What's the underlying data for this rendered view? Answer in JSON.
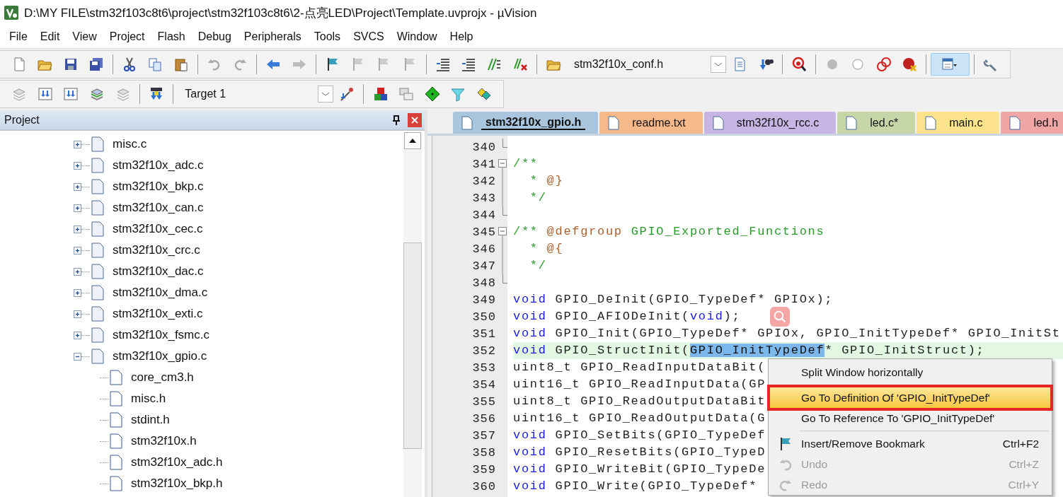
{
  "window": {
    "title": "D:\\MY FILE\\stm32f103c8t6\\project\\stm32f103c8t6\\2-点亮LED\\Project\\Template.uvprojx - µVision"
  },
  "menu_bar": [
    "File",
    "Edit",
    "View",
    "Project",
    "Flash",
    "Debug",
    "Peripherals",
    "Tools",
    "SVCS",
    "Window",
    "Help"
  ],
  "toolbar": {
    "file_combo": "stm32f10x_conf.h",
    "target_combo": "Target 1"
  },
  "project_panel": {
    "title": "Project",
    "tree": [
      {
        "label": "misc.c",
        "expanded": false
      },
      {
        "label": "stm32f10x_adc.c",
        "expanded": false
      },
      {
        "label": "stm32f10x_bkp.c",
        "expanded": false
      },
      {
        "label": "stm32f10x_can.c",
        "expanded": false
      },
      {
        "label": "stm32f10x_cec.c",
        "expanded": false
      },
      {
        "label": "stm32f10x_crc.c",
        "expanded": false
      },
      {
        "label": "stm32f10x_dac.c",
        "expanded": false
      },
      {
        "label": "stm32f10x_dma.c",
        "expanded": false
      },
      {
        "label": "stm32f10x_exti.c",
        "expanded": false
      },
      {
        "label": "stm32f10x_fsmc.c",
        "expanded": false
      },
      {
        "label": "stm32f10x_gpio.c",
        "expanded": true,
        "children": [
          {
            "label": "core_cm3.h"
          },
          {
            "label": "misc.h"
          },
          {
            "label": "stdint.h"
          },
          {
            "label": "stm32f10x.h"
          },
          {
            "label": "stm32f10x_adc.h"
          },
          {
            "label": "stm32f10x_bkp.h"
          }
        ]
      }
    ]
  },
  "editor": {
    "tabs": [
      {
        "label": "stm32f10x_gpio.h",
        "selected": true,
        "color": "#a9c6de"
      },
      {
        "label": "readme.txt",
        "selected": false,
        "color": "#f7b98a"
      },
      {
        "label": "stm32f10x_rcc.c",
        "selected": false,
        "color": "#c7b5e3"
      },
      {
        "label": "led.c*",
        "selected": false,
        "color": "#c6d6a9"
      },
      {
        "label": "main.c",
        "selected": false,
        "color": "#fde48c"
      },
      {
        "label": "led.h",
        "selected": false,
        "color": "#f1a6a6"
      }
    ],
    "lines": [
      {
        "number": "340",
        "kind": "fold-end",
        "current": false
      },
      {
        "number": "341",
        "kind": "fold-start",
        "current": false,
        "segments": [
          {
            "kind": "comment",
            "text": "/**"
          }
        ]
      },
      {
        "number": "342",
        "kind": "fold-body",
        "current": false,
        "segments": [
          {
            "kind": "comment",
            "text": "  * "
          },
          {
            "kind": "tag",
            "text": "@}"
          }
        ]
      },
      {
        "number": "343",
        "kind": "fold-body",
        "current": false,
        "segments": [
          {
            "kind": "comment",
            "text": "  */"
          }
        ]
      },
      {
        "number": "344",
        "kind": "fold-end",
        "current": false
      },
      {
        "number": "345",
        "kind": "fold-start",
        "current": false,
        "segments": [
          {
            "kind": "comment",
            "text": "/** "
          },
          {
            "kind": "tag",
            "text": "@defgroup"
          },
          {
            "kind": "comment",
            "text": " GPIO_Exported_Functions"
          }
        ]
      },
      {
        "number": "346",
        "kind": "fold-body",
        "current": false,
        "segments": [
          {
            "kind": "comment",
            "text": "  * "
          },
          {
            "kind": "tag",
            "text": "@{"
          }
        ]
      },
      {
        "number": "347",
        "kind": "fold-body",
        "current": false,
        "segments": [
          {
            "kind": "comment",
            "text": "  */"
          }
        ]
      },
      {
        "number": "348",
        "kind": "fold-end",
        "current": false
      },
      {
        "number": "349",
        "current": false,
        "segments": [
          {
            "kind": "keyword",
            "text": "void"
          },
          {
            "kind": "plain",
            "text": " GPIO_DeInit(GPIO_TypeDef* GPIOx);"
          }
        ]
      },
      {
        "number": "350",
        "current": false,
        "segments": [
          {
            "kind": "keyword",
            "text": "void"
          },
          {
            "kind": "plain",
            "text": " GPIO_AFIODeInit("
          },
          {
            "kind": "keyword",
            "text": "void"
          },
          {
            "kind": "plain",
            "text": ");"
          }
        ]
      },
      {
        "number": "351",
        "current": false,
        "segments": [
          {
            "kind": "keyword",
            "text": "void"
          },
          {
            "kind": "plain",
            "text": " GPIO_Init(GPIO_TypeDef* GPIOx, GPIO_InitTypeDef* GPIO_InitSt"
          }
        ]
      },
      {
        "number": "352",
        "current": true,
        "segments": [
          {
            "kind": "keyword",
            "text": "void"
          },
          {
            "kind": "plain",
            "text": " GPIO_StructInit("
          },
          {
            "kind": "selection",
            "text": "GPIO_InitTypeDef"
          },
          {
            "kind": "plain",
            "text": "* GPIO_InitStruct);"
          }
        ]
      },
      {
        "number": "353",
        "current": false,
        "segments": [
          {
            "kind": "plain",
            "text": "uint8_t GPIO_ReadInputDataBit("
          }
        ]
      },
      {
        "number": "354",
        "current": false,
        "segments": [
          {
            "kind": "plain",
            "text": "uint16_t GPIO_ReadInputData(GP"
          }
        ]
      },
      {
        "number": "355",
        "current": false,
        "segments": [
          {
            "kind": "plain",
            "text": "uint8_t GPIO_ReadOutputDataBit"
          }
        ]
      },
      {
        "number": "356",
        "current": false,
        "segments": [
          {
            "kind": "plain",
            "text": "uint16_t GPIO_ReadOutputData(G"
          }
        ]
      },
      {
        "number": "357",
        "current": false,
        "segments": [
          {
            "kind": "keyword",
            "text": "void"
          },
          {
            "kind": "plain",
            "text": " GPIO_SetBits(GPIO_TypeDef"
          }
        ]
      },
      {
        "number": "358",
        "current": false,
        "segments": [
          {
            "kind": "keyword",
            "text": "void"
          },
          {
            "kind": "plain",
            "text": " GPIO_ResetBits(GPIO_TypeD"
          }
        ]
      },
      {
        "number": "359",
        "current": false,
        "segments": [
          {
            "kind": "keyword",
            "text": "void"
          },
          {
            "kind": "plain",
            "text": " GPIO_WriteBit(GPIO_TypeDe"
          }
        ]
      },
      {
        "number": "360",
        "current": false,
        "segments": [
          {
            "kind": "keyword",
            "text": "void"
          },
          {
            "kind": "plain",
            "text": " GPIO_Write(GPIO_TypeDef*"
          }
        ]
      }
    ]
  },
  "context_menu": [
    {
      "kind": "item",
      "label": "Split Window horizontally",
      "selected": false,
      "disabled": false
    },
    {
      "kind": "separator"
    },
    {
      "kind": "item",
      "label": "Go To Definition Of 'GPIO_InitTypeDef'",
      "selected": true,
      "disabled": false
    },
    {
      "kind": "item",
      "label": "Go To Reference To 'GPIO_InitTypeDef'",
      "selected": false,
      "disabled": false
    },
    {
      "kind": "separator"
    },
    {
      "kind": "item",
      "label": "Insert/Remove Bookmark",
      "shortcut": "Ctrl+F2",
      "selected": false,
      "disabled": false
    },
    {
      "kind": "item",
      "label": "Undo",
      "shortcut": "Ctrl+Z",
      "selected": false,
      "disabled": true
    },
    {
      "kind": "item",
      "label": "Redo",
      "shortcut": "Ctrl+Y",
      "selected": false,
      "disabled": true
    }
  ]
}
